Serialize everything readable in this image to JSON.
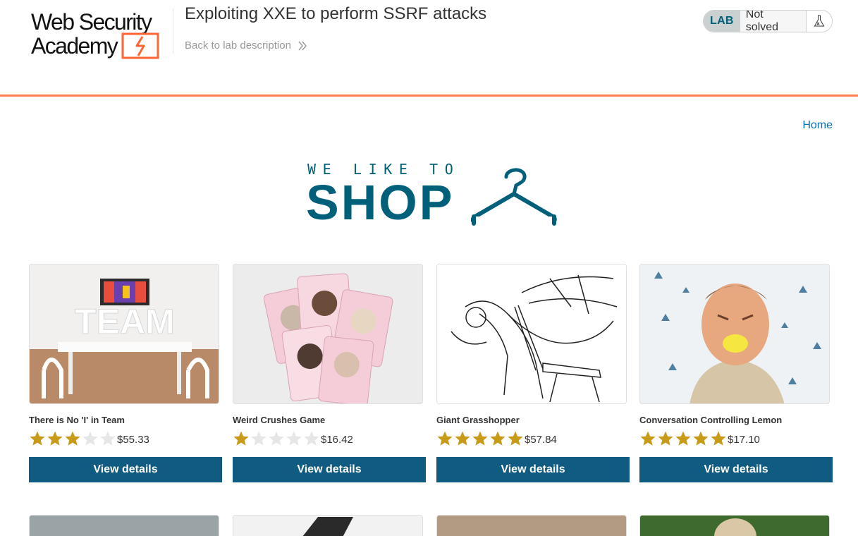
{
  "header": {
    "logo_text_line1": "Web Security",
    "logo_text_line2": "Academy",
    "lab_title": "Exploiting XXE to perform SSRF attacks",
    "back_link_label": "Back to lab description",
    "lab_badge": "LAB",
    "lab_status": "Not solved",
    "accent_color": "#ff6633"
  },
  "nav": {
    "home_label": "Home"
  },
  "banner": {
    "top_text": "WE LIKE TO",
    "main_text": "SHOP",
    "icon": "hanger-icon",
    "color": "#00607a"
  },
  "products": [
    {
      "name": "There is No 'I' in Team",
      "rating": 3,
      "price": "$55.33",
      "button_label": "View details",
      "image": "team-room-image"
    },
    {
      "name": "Weird Crushes Game",
      "rating": 1,
      "price": "$16.42",
      "button_label": "View details",
      "image": "crush-cards-image"
    },
    {
      "name": "Giant Grasshopper",
      "rating": 5,
      "price": "$57.84",
      "button_label": "View details",
      "image": "grasshopper-sketch-image"
    },
    {
      "name": "Conversation Controlling Lemon",
      "rating": 5,
      "price": "$17.10",
      "button_label": "View details",
      "image": "lemon-man-image"
    }
  ],
  "colors": {
    "button": "#0f5b82",
    "star_filled": "#c79a17",
    "star_empty": "#e6e6e6",
    "link": "#0071bc"
  }
}
